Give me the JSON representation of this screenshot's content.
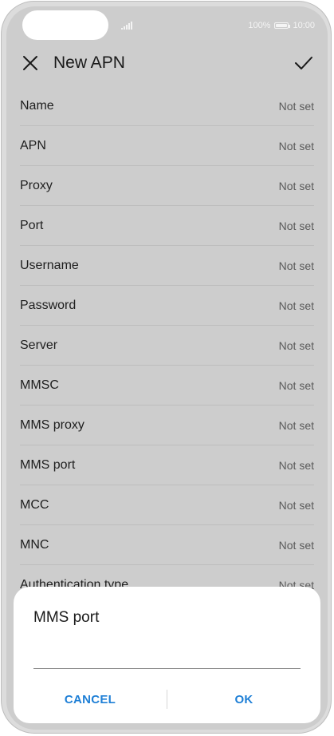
{
  "status_bar": {
    "battery": "100%",
    "time": "10:00"
  },
  "header": {
    "title": "New APN"
  },
  "apn_fields": [
    {
      "label": "Name",
      "value": "Not set"
    },
    {
      "label": "APN",
      "value": "Not set"
    },
    {
      "label": "Proxy",
      "value": "Not set"
    },
    {
      "label": "Port",
      "value": "Not set"
    },
    {
      "label": "Username",
      "value": "Not set"
    },
    {
      "label": "Password",
      "value": "Not set"
    },
    {
      "label": "Server",
      "value": "Not set"
    },
    {
      "label": "MMSC",
      "value": "Not set"
    },
    {
      "label": "MMS proxy",
      "value": "Not set"
    },
    {
      "label": "MMS port",
      "value": "Not set"
    },
    {
      "label": "MCC",
      "value": "Not set"
    },
    {
      "label": "MNC",
      "value": "Not set"
    },
    {
      "label": "Authentication type",
      "value": "Not set"
    }
  ],
  "dialog": {
    "title": "MMS port",
    "input_value": "",
    "cancel_label": "CANCEL",
    "ok_label": "OK"
  },
  "colors": {
    "accent": "#1e7fd6",
    "overlay_bg": "#cdcdcd"
  },
  "icons": {
    "close": "close-icon",
    "confirm": "check-icon"
  }
}
